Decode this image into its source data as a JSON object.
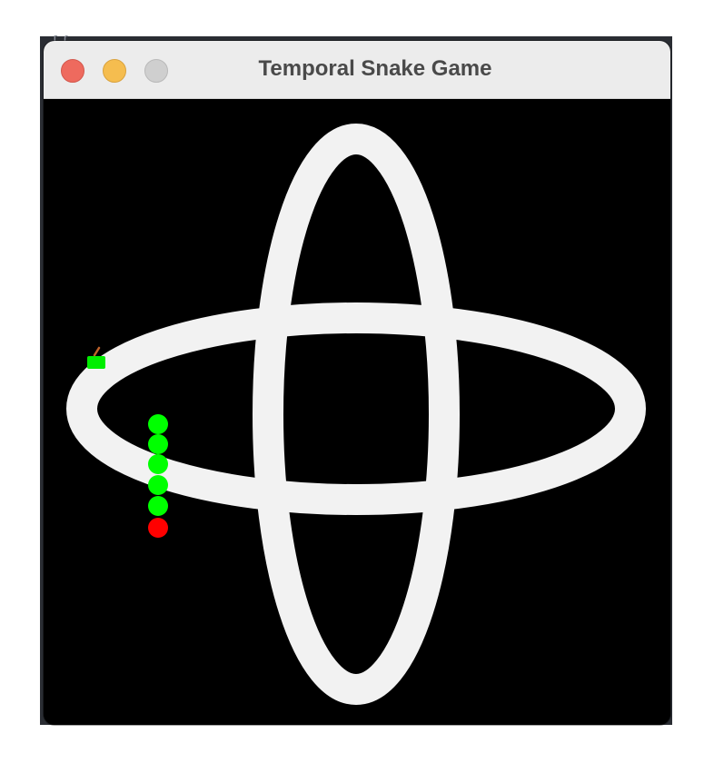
{
  "window": {
    "title": "Temporal Snake Game"
  },
  "colors": {
    "track": "#f2f2f2",
    "background": "#000000",
    "snake_body": "#00ff00",
    "snake_head": "#ff0000",
    "food": "#00ee00",
    "food_stem": "#c0622a"
  },
  "game": {
    "track": "two crossed ellipses (vertical and horizontal) drawn as a thick white loop",
    "snake_segment_count": 6,
    "snake_body_segments": 5,
    "snake_head_segments": 1,
    "food_icon": "apple-icon"
  }
}
